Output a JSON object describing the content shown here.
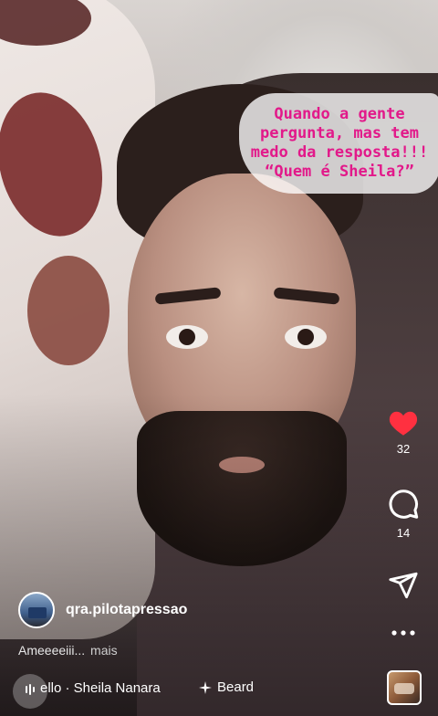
{
  "caption": {
    "text": "Quando a gente\npergunta, mas tem\nmedo da resposta!!!\n“Quem é Sheila?”",
    "color": "#e2198a"
  },
  "actions": {
    "like": {
      "icon": "heart-icon",
      "count": "32",
      "color": "#ff3040",
      "liked": true
    },
    "comment": {
      "icon": "comment-icon",
      "count": "14"
    },
    "share": {
      "icon": "send-icon"
    },
    "more": {
      "icon": "more-horizontal-icon"
    }
  },
  "post": {
    "username": "qra.pilotapressao",
    "description": "Ameeeeiii...",
    "more_label": "mais"
  },
  "music": {
    "text": "ello · Sheila  Nanara",
    "effect_label": "Beard"
  }
}
